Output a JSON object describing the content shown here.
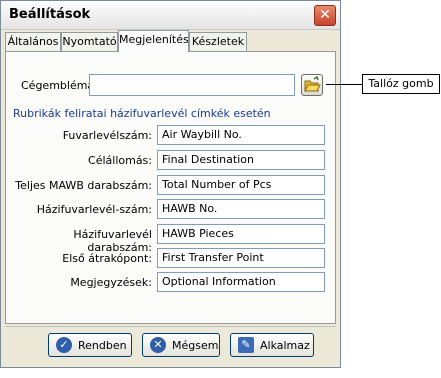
{
  "window": {
    "title": "Beállítások",
    "close_glyph": "✕"
  },
  "tabs": [
    "Általános",
    "Nyomtató",
    "Megjelenítés",
    "Készletek"
  ],
  "active_tab": "Megjelenítés",
  "logo": {
    "label": "Cégembléma:",
    "value": "",
    "browse_icon": "folder-open-icon"
  },
  "section_title": "Rubrikák feliratai házifuvarlevél címkék esetén",
  "fields": [
    {
      "label": "Fuvarlevélszám:",
      "value": "Air Waybill No."
    },
    {
      "label": "Célállomás:",
      "value": "Final Destination"
    },
    {
      "label": "Teljes MAWB darabszám:",
      "value": "Total Number of Pcs"
    },
    {
      "label": "Házifuvarlevél-szám:",
      "value": "HAWB No."
    },
    {
      "label": "Házifuvarlevél darabszám:",
      "value": "HAWB Pieces"
    },
    {
      "label": "Első átrakópont:",
      "value": "First Transfer Point"
    },
    {
      "label": "Megjegyzések:",
      "value": "Optional Information"
    }
  ],
  "buttons": {
    "ok": "Rendben",
    "cancel": "Mégsem",
    "apply": "Alkalmaz"
  },
  "callout": "Tallóz gomb",
  "colors": {
    "section_title": "#1a3c8c",
    "button_border": "#003c74"
  }
}
